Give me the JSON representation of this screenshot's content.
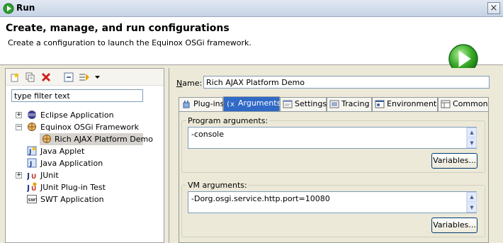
{
  "window": {
    "title": "Run",
    "close_glyph": "×"
  },
  "banner": {
    "title": "Create, manage, and run configurations",
    "message": "Create a configuration to launch the Equinox OSGi framework.",
    "icon": "run-icon"
  },
  "left": {
    "toolbar_icons": [
      "new-configuration-icon",
      "duplicate-icon",
      "delete-icon",
      "collapse-all-icon",
      "filter-icon",
      "dropdown-arrow-icon"
    ],
    "filter_text": "type filter text",
    "tree": [
      {
        "label": "Eclipse Application",
        "expand": "+",
        "icon": "eclipse-icon"
      },
      {
        "label": "Equinox OSGi Framework",
        "expand": "−",
        "icon": "osgi-icon"
      },
      {
        "label": "Rich AJAX Platform Demo",
        "expand": "",
        "icon": "osgi-icon",
        "selected": true
      },
      {
        "label": "Java Applet",
        "expand": "",
        "icon": "java-applet-icon"
      },
      {
        "label": "Java Application",
        "expand": "",
        "icon": "java-app-icon"
      },
      {
        "label": "JUnit",
        "expand": "+",
        "icon": "junit-icon"
      },
      {
        "label": "JUnit Plug-in Test",
        "expand": "",
        "icon": "junit-plugin-icon"
      },
      {
        "label": "SWT Application",
        "expand": "",
        "icon": "swt-icon"
      }
    ]
  },
  "right": {
    "name_label": "Name:",
    "name_value": "Rich AJAX Platform Demo",
    "tabs": [
      {
        "label": "Plug-ins",
        "icon": "plugin-icon"
      },
      {
        "label": "Arguments",
        "icon": "arguments-icon",
        "selected": true
      },
      {
        "label": "Settings",
        "icon": "settings-icon"
      },
      {
        "label": "Tracing",
        "icon": "tracing-icon"
      },
      {
        "label": "Environment",
        "icon": "environment-icon"
      },
      {
        "label": "Common",
        "icon": "common-icon"
      }
    ],
    "program_args": {
      "label": "Program arguments:",
      "value": "-console",
      "variables_button": "Variables..."
    },
    "vm_args": {
      "label": "VM arguments:",
      "value": "-Dorg.osgi.service.http.port=10080",
      "variables_button": "Variables..."
    }
  }
}
